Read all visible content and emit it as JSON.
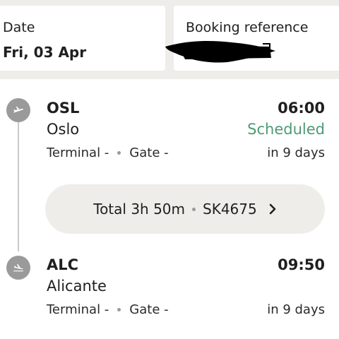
{
  "summary": {
    "date_label": "Date",
    "date_value": "Fri, 03 Apr",
    "booking_label": "Booking reference"
  },
  "departure": {
    "code": "OSL",
    "city": "Oslo",
    "time": "06:00",
    "status": "Scheduled",
    "terminal": "Terminal -",
    "gate": "Gate -",
    "relative": "in 9 days"
  },
  "flight": {
    "duration": "Total 3h 50m",
    "number": "SK4675"
  },
  "arrival": {
    "code": "ALC",
    "city": "Alicante",
    "time": "09:50",
    "terminal": "Terminal -",
    "gate": "Gate -",
    "relative": "in 9 days"
  },
  "colors": {
    "status_green": "#4e9a75",
    "band_grey": "#efedea",
    "icon_grey": "#9a9a9a"
  },
  "icons": {
    "departure": "plane-takeoff-icon",
    "arrival": "plane-landing-icon",
    "chevron": "chevron-right-icon"
  }
}
